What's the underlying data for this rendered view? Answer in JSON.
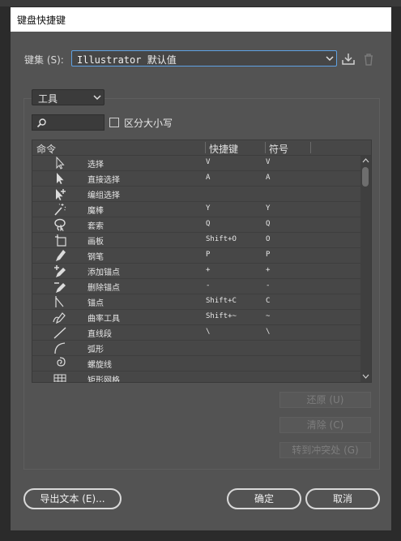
{
  "dialog": {
    "title": "键盘快捷键"
  },
  "keyset": {
    "label": "键集 (S):",
    "selected": "Illustrator 默认值"
  },
  "filter": {
    "category": "工具",
    "search_placeholder": "",
    "case_label": "区分大小写",
    "case_checked": false
  },
  "table": {
    "headers": [
      "命令",
      "快捷键",
      "符号"
    ],
    "rows": [
      {
        "icon": "selection-arrow-icon",
        "name": "选择",
        "shortcut": "V",
        "symbol": "V"
      },
      {
        "icon": "direct-selection-icon",
        "name": "直接选择",
        "shortcut": "A",
        "symbol": "A"
      },
      {
        "icon": "group-selection-icon",
        "name": "编组选择",
        "shortcut": "",
        "symbol": ""
      },
      {
        "icon": "magic-wand-icon",
        "name": "魔棒",
        "shortcut": "Y",
        "symbol": "Y"
      },
      {
        "icon": "lasso-icon",
        "name": "套索",
        "shortcut": "Q",
        "symbol": "Q"
      },
      {
        "icon": "artboard-icon",
        "name": "画板",
        "shortcut": "Shift+O",
        "symbol": "O"
      },
      {
        "icon": "pen-icon",
        "name": "钢笔",
        "shortcut": "P",
        "symbol": "P"
      },
      {
        "icon": "add-anchor-icon",
        "name": "添加锚点",
        "shortcut": "+",
        "symbol": "+"
      },
      {
        "icon": "delete-anchor-icon",
        "name": "删除锚点",
        "shortcut": "-",
        "symbol": "-"
      },
      {
        "icon": "anchor-point-icon",
        "name": "锚点",
        "shortcut": "Shift+C",
        "symbol": "C"
      },
      {
        "icon": "curvature-icon",
        "name": "曲率工具",
        "shortcut": "Shift+~",
        "symbol": "~"
      },
      {
        "icon": "line-segment-icon",
        "name": "直线段",
        "shortcut": "\\",
        "symbol": "\\"
      },
      {
        "icon": "arc-icon",
        "name": "弧形",
        "shortcut": "",
        "symbol": ""
      },
      {
        "icon": "spiral-icon",
        "name": "螺旋线",
        "shortcut": "",
        "symbol": ""
      },
      {
        "icon": "rectangular-grid-icon",
        "name": "矩形网格",
        "shortcut": "",
        "symbol": ""
      }
    ]
  },
  "side_buttons": {
    "undo": "还原 (U)",
    "clear": "清除 (C)",
    "goto_conflict": "转到冲突处 (G)"
  },
  "footer": {
    "export": "导出文本 (E)...",
    "ok": "确定",
    "cancel": "取消"
  },
  "colors": {
    "dialog_bg": "#535353",
    "focus_border": "#5fa2e4",
    "title_bg": "#ffffff"
  }
}
